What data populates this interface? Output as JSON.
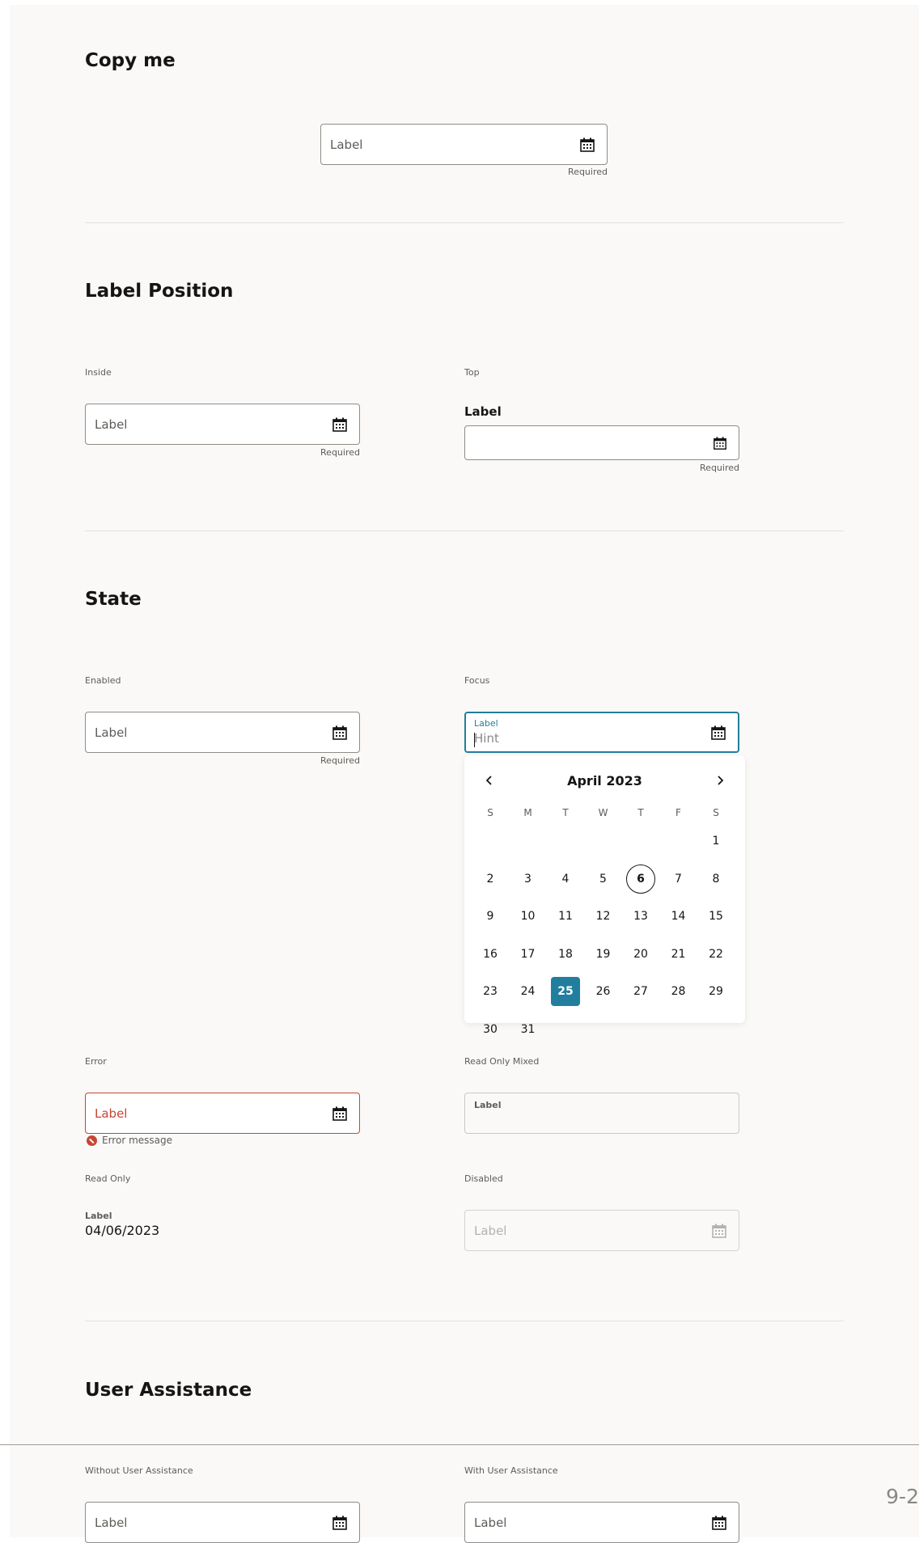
{
  "sections": {
    "copy_me": "Copy me",
    "label_position": "Label Position",
    "state": "State",
    "user_assistance": "User Assistance"
  },
  "copy_me": {
    "field_label": "Label",
    "required": "Required"
  },
  "label_position": {
    "inside": {
      "caption": "Inside",
      "field_label": "Label",
      "required": "Required"
    },
    "top": {
      "caption": "Top",
      "field_label": "Label",
      "required": "Required"
    }
  },
  "state": {
    "enabled": {
      "caption": "Enabled",
      "field_label": "Label",
      "required": "Required"
    },
    "focus": {
      "caption": "Focus",
      "field_label": "Label",
      "hint": "Hint"
    },
    "error": {
      "caption": "Error",
      "field_label": "Label",
      "message": "Error message"
    },
    "read_only_mixed": {
      "caption": "Read Only Mixed",
      "field_label": "Label"
    },
    "read_only": {
      "caption": "Read Only",
      "field_label": "Label",
      "value": "04/06/2023"
    },
    "disabled": {
      "caption": "Disabled",
      "field_label": "Label"
    }
  },
  "calendar": {
    "month_year": "April 2023",
    "weekdays": [
      "S",
      "M",
      "T",
      "W",
      "T",
      "F",
      "S"
    ],
    "first_weekday": 6,
    "days_in_month": 31,
    "today": 6,
    "selected": 25
  },
  "user_assistance": {
    "without": {
      "caption": "Without User Assistance",
      "field_label": "Label"
    },
    "with": {
      "caption": "With User Assistance",
      "field_label": "Label"
    }
  },
  "page_number": "9-2",
  "colors": {
    "accent": "#227e9e",
    "error": "#c74634",
    "text": "#161513",
    "background": "#faf9f7"
  },
  "icons": {
    "field": "calendar-icon",
    "prev": "chevron-left-icon",
    "next": "chevron-right-icon",
    "error": "error-icon"
  }
}
